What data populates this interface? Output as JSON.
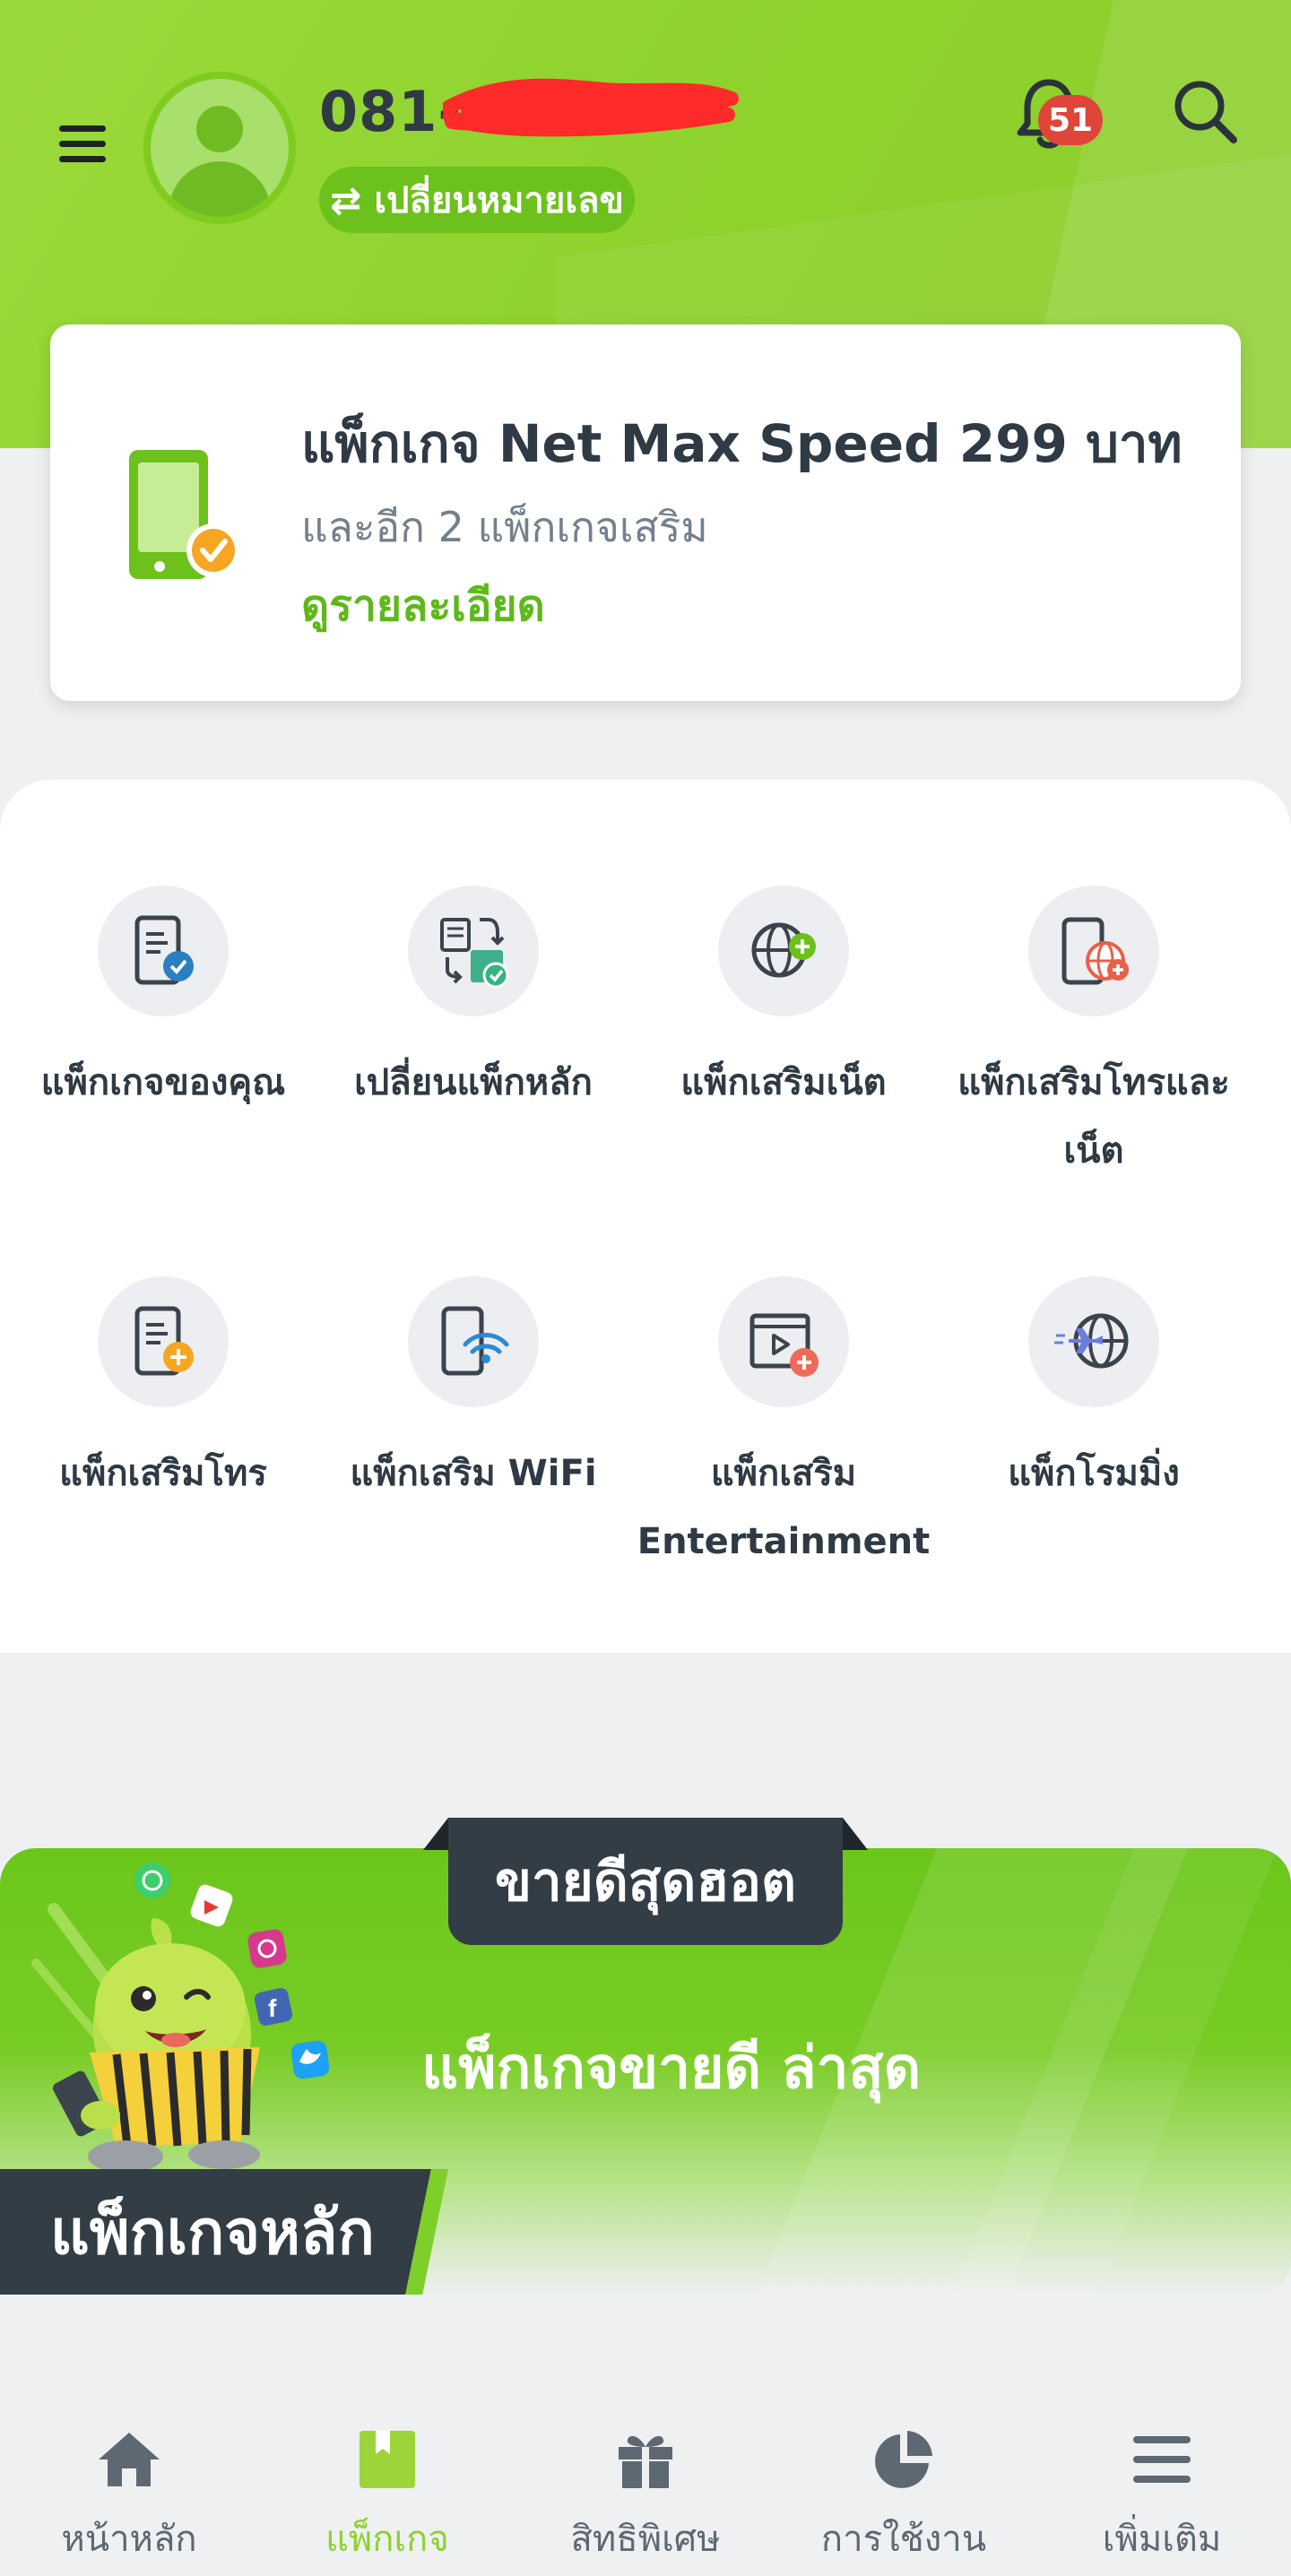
{
  "header": {
    "phone_number": "081-8",
    "switch_number_label": "เปลี่ยนหมายเลข",
    "notification_count": "51"
  },
  "package_card": {
    "title": "แพ็กเกจ Net Max Speed 299 บาท",
    "subtitle": "และอีก 2 แพ็กเกจเสริม",
    "details_link": "ดูรายละเอียด"
  },
  "menu_grid": {
    "items": [
      {
        "label": "แพ็กเกจของคุณ",
        "icon": "package-list-icon"
      },
      {
        "label": "เปลี่ยนแพ็กหลัก",
        "icon": "swap-package-icon"
      },
      {
        "label": "แพ็กเสริมเน็ต",
        "icon": "globe-add-icon"
      },
      {
        "label": "แพ็กเสริมโทรและเน็ต",
        "icon": "phone-globe-icon"
      },
      {
        "label": "แพ็กเสริมโทร",
        "icon": "phone-add-icon"
      },
      {
        "label": "แพ็กเสริม WiFi",
        "icon": "phone-wifi-icon"
      },
      {
        "label": "แพ็กเสริม Entertainment",
        "icon": "video-add-icon"
      },
      {
        "label": "แพ็กโรมมิ่ง",
        "icon": "airplane-globe-icon"
      }
    ]
  },
  "promo": {
    "tab_label": "ขายดีสุดฮอต",
    "title": "แพ็กเกจขายดี ล่าสุด",
    "section_label": "แพ็กเกจหลัก"
  },
  "bottom_nav": {
    "items": [
      {
        "label": "หน้าหลัก",
        "icon": "home-icon",
        "active": false
      },
      {
        "label": "แพ็กเกจ",
        "icon": "package-icon",
        "active": true
      },
      {
        "label": "สิทธิพิเศษ",
        "icon": "gift-icon",
        "active": false
      },
      {
        "label": "การใช้งาน",
        "icon": "pie-chart-icon",
        "active": false
      },
      {
        "label": "เพิ่มเติม",
        "icon": "more-menu-icon",
        "active": false
      }
    ]
  },
  "colors": {
    "brand_green": "#8ed22c",
    "dark": "#333d45",
    "badge_red": "#e0453a",
    "link_green": "#5fb81b"
  }
}
